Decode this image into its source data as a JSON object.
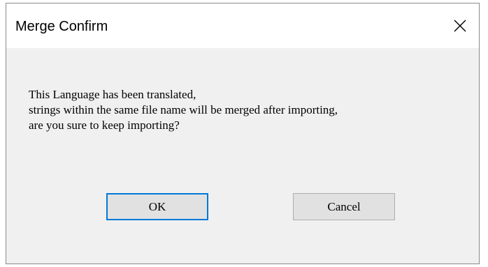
{
  "dialog": {
    "title": "Merge Confirm",
    "close_icon": "close-icon",
    "message_lines": [
      "This Language has been translated,",
      "strings within the same file name will be merged after importing,",
      "are you sure to keep importing?"
    ],
    "ok_label": "OK",
    "cancel_label": "Cancel",
    "accent_color": "#0078d7"
  }
}
